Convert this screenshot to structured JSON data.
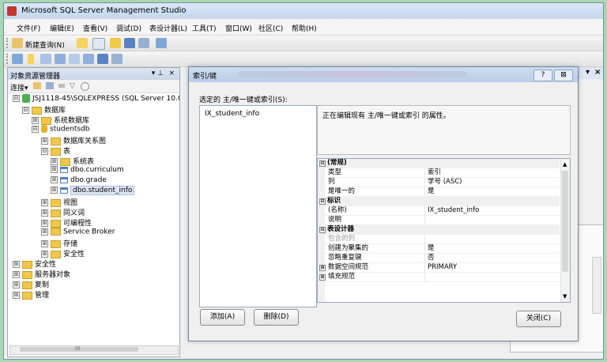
{
  "window": {
    "title": "Microsoft SQL Server Management Studio"
  },
  "menu": [
    "文件(F)",
    "编辑(E)",
    "查看(V)",
    "调试(D)",
    "表设计器(L)",
    "工具(T)",
    "窗口(W)",
    "社区(C)",
    "帮助(H)"
  ],
  "toolbar": {
    "new_query_label": "新建查询(N)"
  },
  "object_explorer": {
    "title": "对象资源管理器",
    "pin": "▾ ⊥",
    "close": "×",
    "connect_label": "连接▾",
    "tree": [
      {
        "label": "JSJ1118-45\\SQLEXPRESS (SQL Server 10.0",
        "type": "server",
        "expander": "⊟"
      },
      {
        "label": "数据库",
        "type": "folder",
        "expander": "⊟"
      },
      {
        "label": "系统数据库",
        "type": "folder",
        "expander": "⊞"
      },
      {
        "label": "studentsdb",
        "type": "db",
        "expander": "⊟"
      },
      {
        "label": "数据库关系图",
        "type": "folder",
        "expander": "⊞"
      },
      {
        "label": "表",
        "type": "folder",
        "expander": "⊟"
      },
      {
        "label": "系统表",
        "type": "folder",
        "expander": "⊞"
      },
      {
        "label": "dbo.curriculum",
        "type": "table",
        "expander": "⊞"
      },
      {
        "label": "dbo.grade",
        "type": "table",
        "expander": "⊞"
      },
      {
        "label": "dbo.student_info",
        "type": "table",
        "expander": "⊞",
        "highlight": true
      },
      {
        "label": "视图",
        "type": "folder",
        "expander": "⊞"
      },
      {
        "label": "同义词",
        "type": "folder",
        "expander": "⊞"
      },
      {
        "label": "可编程性",
        "type": "folder",
        "expander": "⊞"
      },
      {
        "label": "Service Broker",
        "type": "folder",
        "expander": "⊞"
      },
      {
        "label": "存储",
        "type": "folder",
        "expander": "⊞"
      },
      {
        "label": "安全性",
        "type": "folder",
        "expander": "⊞"
      },
      {
        "label": "安全性",
        "type": "folder",
        "expander": "⊞"
      },
      {
        "label": "服务器对象",
        "type": "folder",
        "expander": "⊞"
      },
      {
        "label": "复制",
        "type": "folder",
        "expander": "⊞"
      },
      {
        "label": "管理",
        "type": "folder",
        "expander": "⊞"
      }
    ],
    "scroll_mark": "III"
  },
  "doc_tab": {
    "pin": "▾",
    "close": "×"
  },
  "dialog": {
    "title": "索引/键",
    "help_button": "?",
    "close_button": "⊠",
    "selected_label": "选定的 主/唯一键或索引(S):",
    "selected_item": "IX_student_info",
    "description": "正在编辑现有 主/唯一键或索引 的属性。",
    "properties": [
      {
        "key": "(常规)",
        "value": "",
        "category": true,
        "expander": "⊟"
      },
      {
        "key": "类型",
        "value": "索引"
      },
      {
        "key": "列",
        "value": "学号 (ASC)"
      },
      {
        "key": "是唯一的",
        "value": "是"
      },
      {
        "key": "标识",
        "value": "",
        "category": true,
        "expander": "⊟"
      },
      {
        "key": "(名称)",
        "value": "IX_student_info"
      },
      {
        "key": "说明",
        "value": ""
      },
      {
        "key": "表设计器",
        "value": "",
        "category": true,
        "expander": "⊟"
      },
      {
        "key": "包含的列",
        "value": "",
        "disabled": true
      },
      {
        "key": "创建为聚集的",
        "value": "是"
      },
      {
        "key": "忽略重复键",
        "value": "否"
      },
      {
        "key": "数据空间规范",
        "value": "PRIMARY",
        "expander": "⊞"
      },
      {
        "key": "填充规范",
        "value": "",
        "expander": "⊞"
      }
    ],
    "add_button": "添加(A)",
    "delete_button": "删除(D)",
    "close_btn": "关闭(C)"
  },
  "colors": {
    "accent": "#4a7fc1",
    "folder": "#f0c84a",
    "background": "#a8d8b0"
  }
}
